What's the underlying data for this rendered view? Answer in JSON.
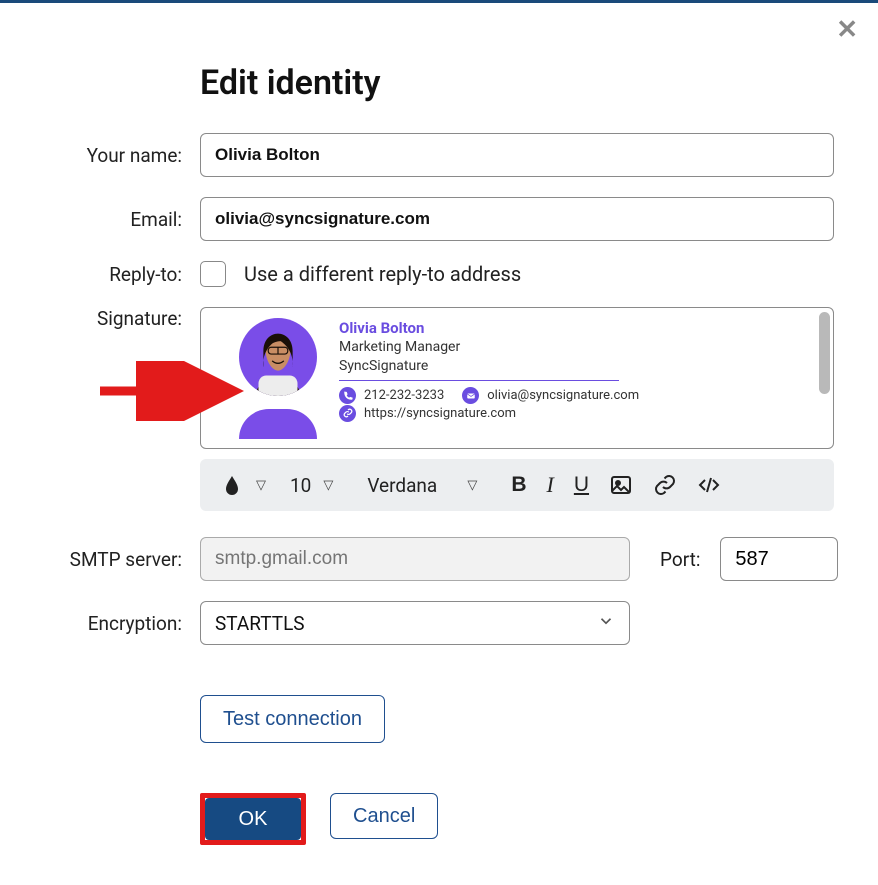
{
  "title": "Edit identity",
  "labels": {
    "your_name": "Your name:",
    "email": "Email:",
    "reply_to": "Reply-to:",
    "signature": "Signature:",
    "smtp": "SMTP server:",
    "port": "Port:",
    "encryption": "Encryption:"
  },
  "fields": {
    "your_name": "Olivia Bolton",
    "email": "olivia@syncsignature.com",
    "reply_to_checkbox_label": "Use a different reply-to address",
    "smtp_placeholder": "smtp.gmail.com",
    "port": "587",
    "encryption_value": "STARTTLS"
  },
  "signature": {
    "name": "Olivia Bolton",
    "title": "Marketing Manager",
    "company": "SyncSignature",
    "phone": "212-232-3233",
    "email": "olivia@syncsignature.com",
    "website": "https://syncsignature.com"
  },
  "toolbar": {
    "font_size": "10",
    "font_family": "Verdana"
  },
  "buttons": {
    "test": "Test connection",
    "ok": "OK",
    "cancel": "Cancel"
  }
}
